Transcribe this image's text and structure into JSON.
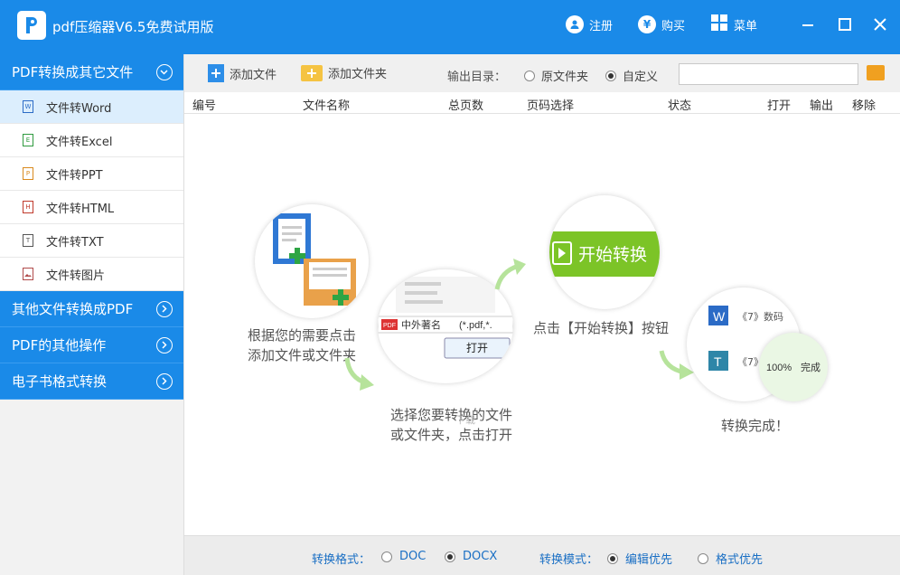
{
  "titlebar": {
    "title": "pdf压缩器V6.5免费试用版",
    "register": "注册",
    "buy": "购买",
    "menu": "菜单",
    "accent": "#1a8ae8"
  },
  "sidebar": {
    "categories": [
      {
        "label": "PDF转换成其它文件",
        "expanded": true
      },
      {
        "label": "其他文件转换成PDF"
      },
      {
        "label": "PDF的其他操作"
      },
      {
        "label": "电子书格式转换"
      }
    ],
    "items": [
      {
        "label": "文件转Word",
        "icon": "W"
      },
      {
        "label": "文件转Excel",
        "icon": "E"
      },
      {
        "label": "文件转PPT",
        "icon": "P"
      },
      {
        "label": "文件转HTML",
        "icon": "H"
      },
      {
        "label": "文件转TXT",
        "icon": "T"
      },
      {
        "label": "文件转图片",
        "icon": "img"
      }
    ]
  },
  "toolbar": {
    "add_file": "添加文件",
    "add_folder": "添加文件夹",
    "output_label": "输出目录：",
    "opt_original": "原文件夹",
    "opt_custom": "自定义",
    "path_value": ""
  },
  "table": {
    "headers": [
      "编号",
      "文件名称",
      "总页数",
      "页码选择",
      "状态",
      "打开",
      "输出",
      "移除"
    ]
  },
  "steps": {
    "step1": [
      "根据您的需要点击",
      "添加文件或文件夹"
    ],
    "step2": [
      "选择您要转换的文件",
      "或文件夹，点击打开"
    ],
    "step2_file": "中外著名",
    "step2_ext": "(*.pdf,*.",
    "step2_open": "打开",
    "step3": "点击【开始转换】按钮",
    "step3_button": "开始转换",
    "step4": "转换完成！",
    "step4_row1": "《7》数码",
    "step4_row2": "《7》",
    "step4_progress": "100%",
    "step4_done": "完成",
    "watermark": "下载"
  },
  "bottom": {
    "format_label": "转换格式：",
    "doc": "DOC",
    "docx": "DOCX",
    "mode_label": "转换模式：",
    "edit_first": "编辑优先",
    "format_first": "格式优先"
  }
}
